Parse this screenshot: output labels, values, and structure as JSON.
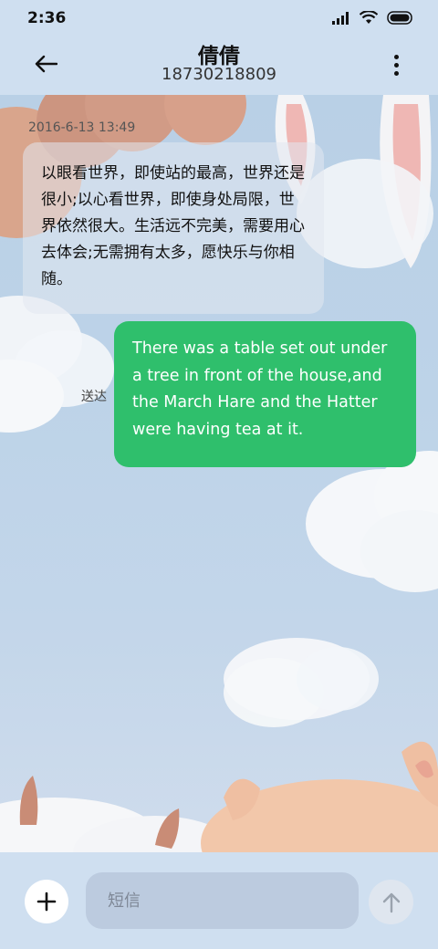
{
  "status_bar": {
    "time": "2:36"
  },
  "header": {
    "title": "倩倩",
    "phone": "18730218809"
  },
  "messages": {
    "timestamp": "2016-6-13 13:49",
    "incoming": "以眼看世界，即使站的最高，世界还是很小;以心看世界，即使身处局限，世界依然很大。生活远不完美，需要用心去体会;无需拥有太多，愿快乐与你相随。",
    "outgoing": "There was a table set out under a tree in front of the house,and the March Hare and the Hatter were having tea at it.",
    "delivered_label": "送达"
  },
  "composer": {
    "placeholder": "短信"
  },
  "colors": {
    "outgoing_bubble": "#2fbf6c",
    "background": "#cfdff0"
  },
  "icons": [
    "signal-icon",
    "wifi-icon",
    "battery-icon",
    "back-arrow-icon",
    "more-vert-icon",
    "plus-icon",
    "send-arrow-icon"
  ]
}
